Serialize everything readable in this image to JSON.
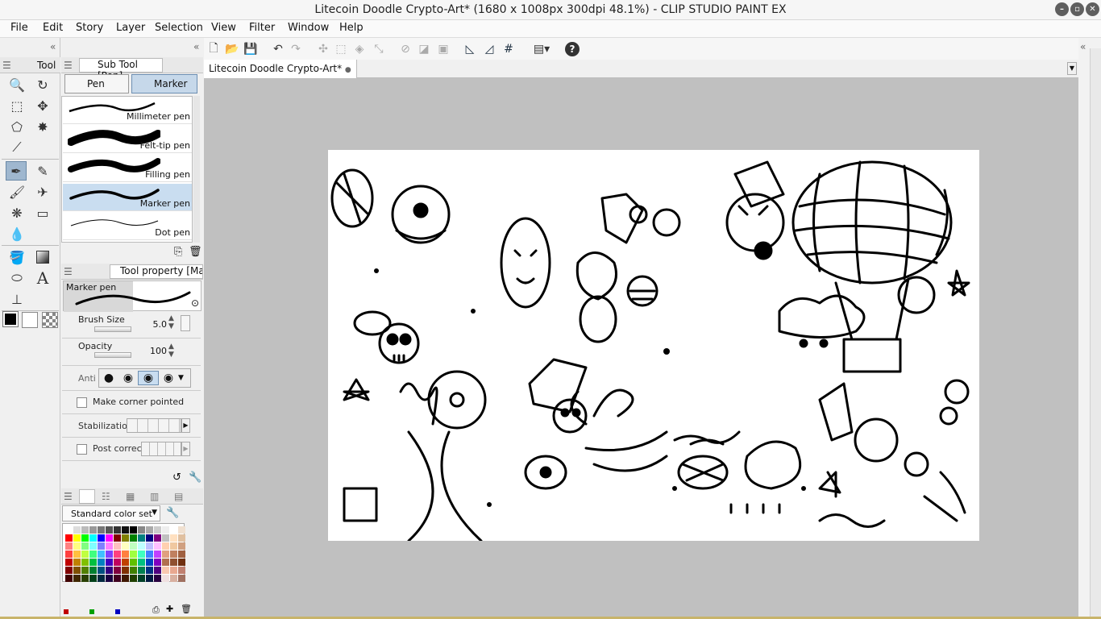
{
  "window": {
    "title": "Litecoin Doodle Crypto-Art* (1680 x 1008px 300dpi 48.1%)  - CLIP STUDIO PAINT EX"
  },
  "menu": [
    "File",
    "Edit",
    "Story",
    "Layer",
    "Selection",
    "View",
    "Filter",
    "Window",
    "Help"
  ],
  "tool_panel": {
    "tab": "Tool"
  },
  "subtool_panel": {
    "tab": "Sub Tool [Pen]",
    "tabs": [
      "Pen",
      "Marker"
    ],
    "brushes": [
      "Millimeter pen",
      "Felt-tip pen",
      "Filling pen",
      "Marker pen",
      "Dot pen"
    ],
    "selected": "Marker pen"
  },
  "property_panel": {
    "tab": "Tool property [Mar",
    "preview_label": "Marker pen",
    "brush_size_label": "Brush Size",
    "brush_size": "5.0",
    "opacity_label": "Opacity",
    "opacity": "100",
    "anti_label": "Anti",
    "corner_label": "Make corner pointed",
    "stab_label": "Stabilizatio",
    "post_label": "Post correc"
  },
  "color_panel": {
    "set": "Standard color set"
  },
  "document": {
    "tab": "Litecoin Doodle Crypto-Art*"
  },
  "colors": {
    "accent": "#9fb7cf",
    "canvas_bg": "#c0c0c0"
  }
}
